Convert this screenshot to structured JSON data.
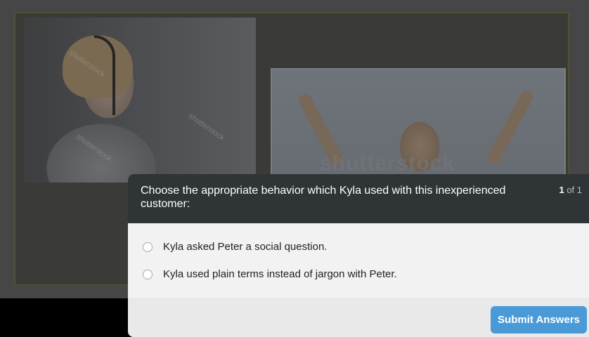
{
  "slide": {
    "watermark": "shutterstock",
    "watermark_small": [
      "shutterstock",
      "shutterstock",
      "shutterstock"
    ]
  },
  "quiz": {
    "question": "Choose the appropriate behavior which Kyla used with this inexperienced customer:",
    "counter_current": "1",
    "counter_suffix": "of 1",
    "options": [
      {
        "label": "Kyla asked Peter a social question.",
        "selected": false
      },
      {
        "label": "Kyla used plain terms instead of jargon with Peter.",
        "selected": false
      }
    ],
    "submit_label": "Submit Answers"
  },
  "colors": {
    "header_bg": "#2f3436",
    "panel_bg": "#f2f2f2",
    "accent": "#4a9ad8"
  }
}
